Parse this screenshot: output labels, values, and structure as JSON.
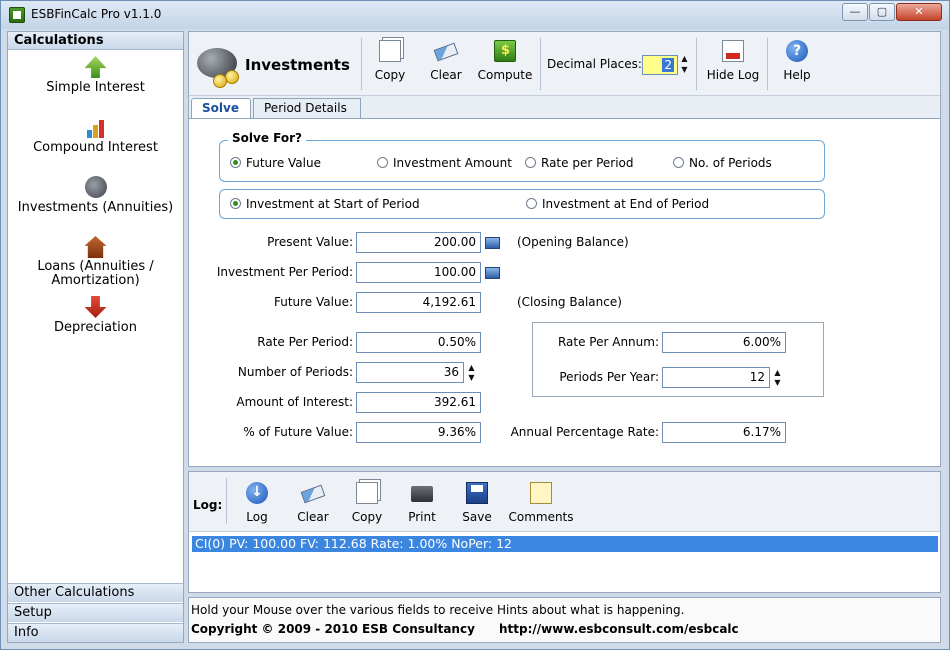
{
  "window": {
    "title": "ESBFinCalc Pro v1.1.0",
    "min": "—",
    "max": "▢",
    "close": "✕"
  },
  "sidebar": {
    "header": "Calculations",
    "items": [
      {
        "label": "Simple Interest",
        "icon": "up-arrow-house-icon"
      },
      {
        "label": "Compound Interest",
        "icon": "bar-chart-icon"
      },
      {
        "label": "Investments (Annuities)",
        "icon": "piggy-bank-icon"
      },
      {
        "label": "Loans (Annuities / Amortization)",
        "icon": "house-icon"
      },
      {
        "label": "Depreciation",
        "icon": "down-arrow-icon"
      }
    ],
    "footer": [
      "Other Calculations",
      "Setup",
      "Info"
    ]
  },
  "toolbar": {
    "title": "Investments",
    "copy": "Copy",
    "clear": "Clear",
    "compute": "Compute",
    "decimal_label": "Decimal Places:",
    "decimal_value": "2",
    "hide_log": "Hide Log",
    "help": "Help",
    "help_glyph": "?"
  },
  "tabs": {
    "solve": "Solve",
    "period": "Period Details"
  },
  "solve_for": {
    "legend": "Solve For?",
    "options": [
      "Future Value",
      "Investment Amount",
      "Rate per Period",
      "No. of Periods"
    ],
    "selected": 0
  },
  "timing": {
    "options": [
      "Investment at Start of Period",
      "Investment at End of Period"
    ],
    "selected": 0
  },
  "fields": {
    "present_value": {
      "label": "Present Value:",
      "value": "200.00",
      "note": "(Opening Balance)"
    },
    "investment_per_period": {
      "label": "Investment Per Period:",
      "value": "100.00"
    },
    "future_value": {
      "label": "Future Value:",
      "value": "4,192.61",
      "note": "(Closing Balance)"
    },
    "rate_per_period": {
      "label": "Rate Per Period:",
      "value": "0.50%"
    },
    "number_of_periods": {
      "label": "Number of Periods:",
      "value": "36"
    },
    "amount_of_interest": {
      "label": "Amount of Interest:",
      "value": "392.61"
    },
    "pct_future_value": {
      "label": "% of Future Value:",
      "value": "9.36%"
    },
    "rate_per_annum": {
      "label": "Rate Per Annum:",
      "value": "6.00%"
    },
    "periods_per_year": {
      "label": "Periods Per Year:",
      "value": "12"
    },
    "apr": {
      "label": "Annual Percentage Rate:",
      "value": "6.17%"
    }
  },
  "log": {
    "label": "Log:",
    "buttons": {
      "log": "Log",
      "clear": "Clear",
      "copy": "Copy",
      "print": "Print",
      "save": "Save",
      "comments": "Comments"
    },
    "entries": [
      "CI(0) PV: 100.00 FV: 112.68 Rate: 1.00% NoPer: 12"
    ]
  },
  "footer": {
    "hint": "Hold your Mouse over the various fields to receive Hints about what is happening.",
    "copyright": "Copyright © 2009 - 2010 ESB Consultancy",
    "url": "http://www.esbconsult.com/esbcalc"
  }
}
